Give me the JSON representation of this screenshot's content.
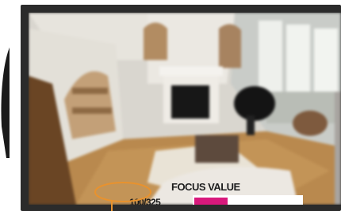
{
  "overlay": {
    "focus_label": "FOCUS VALUE",
    "focus_readout": "100/325",
    "focus_value": 100,
    "focus_max": 325,
    "bar_color": "#d8197c",
    "bar_background": "#ffffff"
  },
  "frame": {
    "bezel_color": "#2b2b2b",
    "callout_color": "#e8922e"
  }
}
